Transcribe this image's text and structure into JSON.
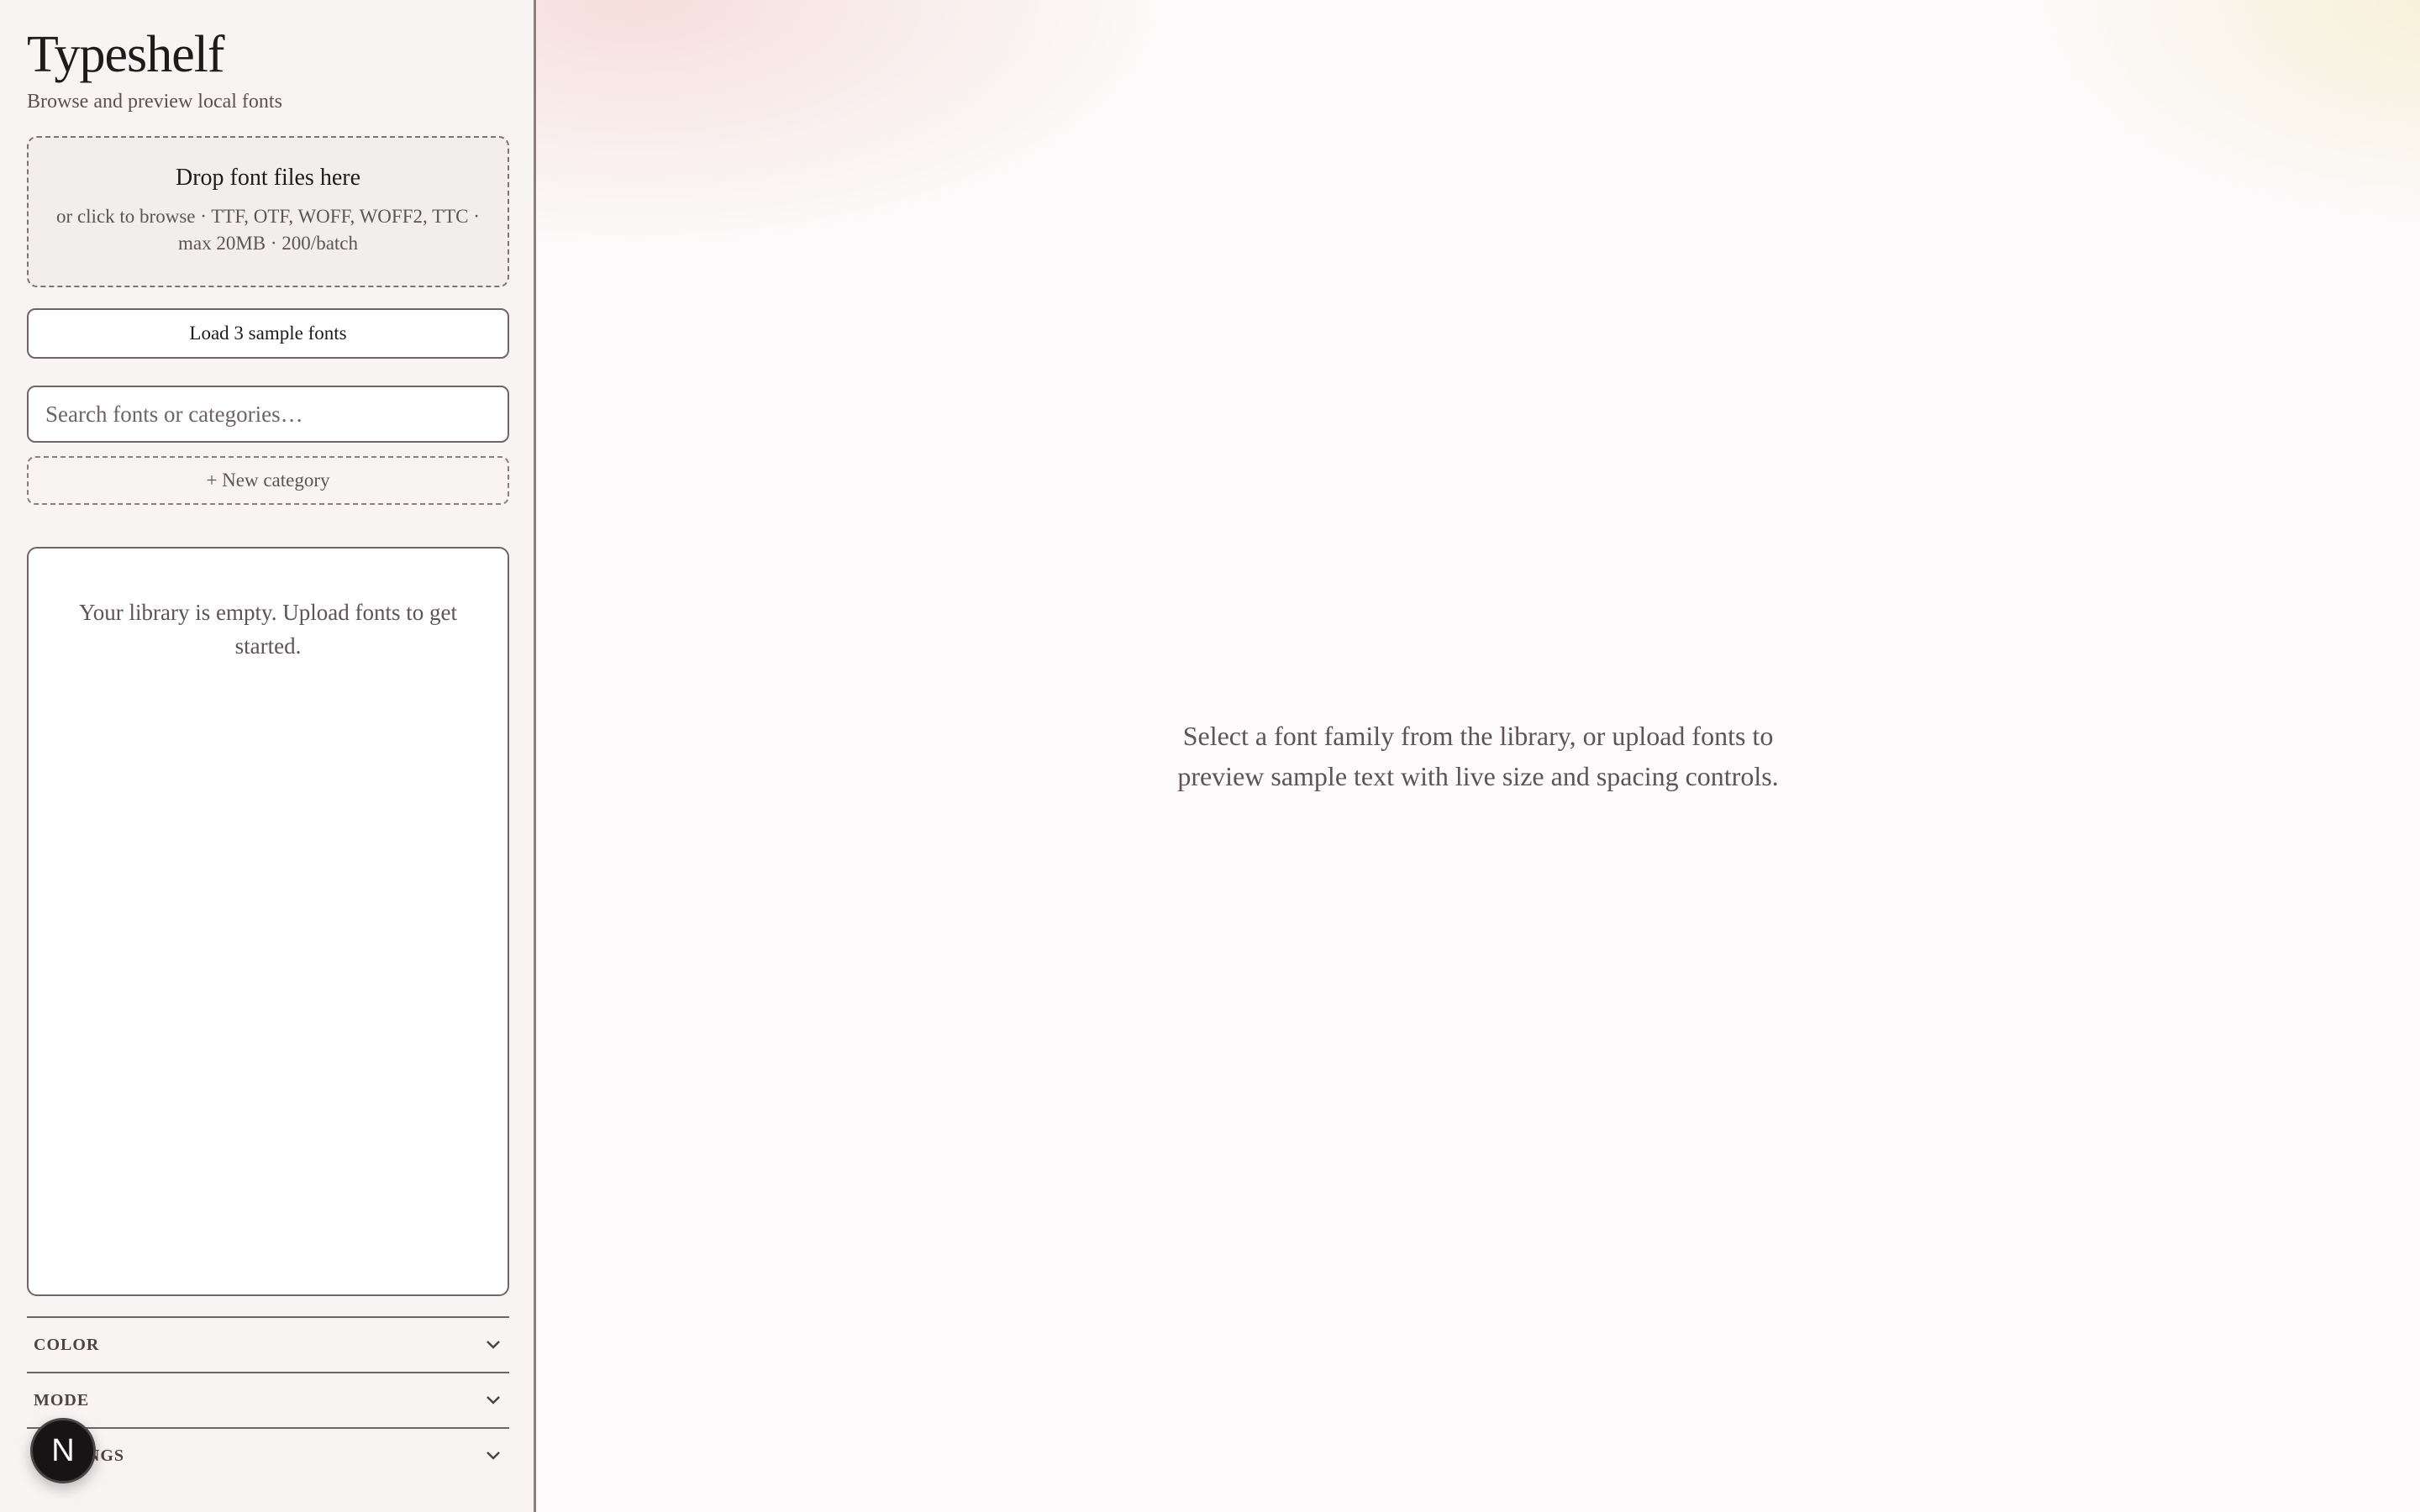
{
  "sidebar": {
    "title": "Typeshelf",
    "subtitle": "Browse and preview local fonts",
    "dropzone": {
      "title": "Drop font files here",
      "hint": "or click to browse · TTF, OTF, WOFF, WOFF2, TTC · max 20MB · 200/batch"
    },
    "sample_button": "Load 3 sample fonts",
    "search": {
      "placeholder": "Search fonts or categories…",
      "value": ""
    },
    "new_category": "+ New category",
    "library_empty": "Your library is empty. Upload fonts to get started.",
    "sections": [
      {
        "label": "COLOR",
        "icon": "chevron-down-icon"
      },
      {
        "label": "MODE",
        "icon": "chevron-down-icon"
      },
      {
        "label": "SETTINGS",
        "icon": "chevron-down-icon"
      }
    ],
    "badge": "N"
  },
  "main": {
    "empty_line1": "Select a font family from the library, or upload fonts to",
    "empty_line2": "preview sample text with live size and spacing controls."
  },
  "colors": {
    "sidebar_bg": "#f8f4f3",
    "border": "#6f6567",
    "muted_text": "#5e5456",
    "badge_bg": "#161414"
  }
}
